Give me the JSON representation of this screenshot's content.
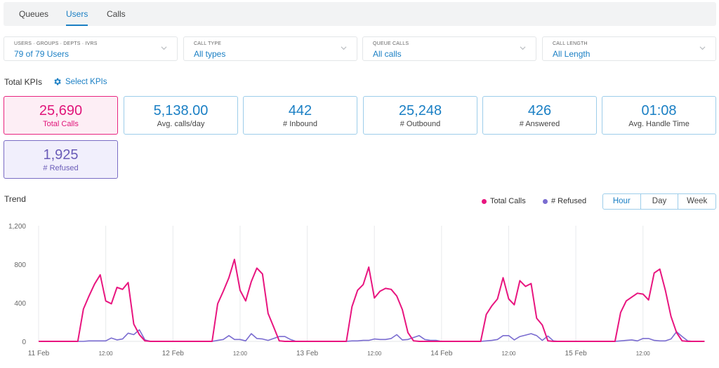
{
  "tabs": [
    {
      "label": "Queues",
      "active": false
    },
    {
      "label": "Users",
      "active": true
    },
    {
      "label": "Calls",
      "active": false
    }
  ],
  "filters": [
    {
      "label": "USERS · GROUPS · DEPTS · IVRS",
      "value": "79 of 79 Users"
    },
    {
      "label": "CALL TYPE",
      "value": "All types"
    },
    {
      "label": "QUEUE CALLS",
      "value": "All calls"
    },
    {
      "label": "CALL LENGTH",
      "value": "All Length"
    }
  ],
  "kpi_section": {
    "title": "Total KPIs",
    "select_label": "Select KPIs",
    "select_icon": "gear-icon"
  },
  "kpis": [
    {
      "value": "25,690",
      "label": "Total Calls",
      "style": "pink"
    },
    {
      "value": "5,138.00",
      "label": "Avg. calls/day",
      "style": "blue"
    },
    {
      "value": "442",
      "label": "# Inbound",
      "style": "blue"
    },
    {
      "value": "25,248",
      "label": "# Outbound",
      "style": "blue"
    },
    {
      "value": "426",
      "label": "# Answered",
      "style": "blue"
    },
    {
      "value": "01:08",
      "label": "Avg. Handle Time",
      "style": "blue"
    },
    {
      "value": "1,925",
      "label": "# Refused",
      "style": "purple"
    }
  ],
  "trend": {
    "title": "Trend",
    "granularity_options": [
      "Hour",
      "Day",
      "Week"
    ],
    "granularity_selected": "Hour"
  },
  "colors": {
    "accent": "#1a7fc4",
    "total_calls": "#e8157f",
    "refused": "#7a6cd0"
  },
  "chart_data": {
    "type": "line",
    "title": "Trend",
    "xlabel": "",
    "ylabel": "",
    "x_unit": "hour",
    "x_start": "11 Feb 00:00",
    "x_tick_labels": [
      "11 Feb",
      "12:00",
      "12 Feb",
      "12:00",
      "13 Feb",
      "12:00",
      "14 Feb",
      "12:00",
      "15 Feb",
      "12:00"
    ],
    "y_ticks": [
      0,
      400,
      800,
      1200
    ],
    "y_tick_labels": [
      "0",
      "400",
      "800",
      "1,200"
    ],
    "ylim": [
      0,
      1200
    ],
    "grid": "vertical",
    "legend": "top-right",
    "series": [
      {
        "name": "Total Calls",
        "color": "#e8157f",
        "values": [
          0,
          0,
          0,
          0,
          0,
          0,
          0,
          0,
          335,
          470,
          595,
          690,
          420,
          390,
          560,
          540,
          610,
          180,
          70,
          5,
          0,
          0,
          0,
          0,
          0,
          0,
          0,
          0,
          0,
          0,
          0,
          0,
          390,
          520,
          660,
          850,
          530,
          420,
          620,
          760,
          700,
          290,
          150,
          5,
          0,
          0,
          0,
          0,
          0,
          0,
          0,
          0,
          0,
          0,
          0,
          0,
          360,
          530,
          590,
          770,
          450,
          520,
          550,
          540,
          470,
          330,
          90,
          5,
          0,
          0,
          0,
          0,
          0,
          0,
          0,
          0,
          0,
          0,
          0,
          0,
          280,
          370,
          440,
          660,
          440,
          380,
          630,
          570,
          600,
          240,
          170,
          5,
          0,
          0,
          0,
          0,
          0,
          0,
          0,
          0,
          0,
          0,
          0,
          0,
          300,
          420,
          460,
          500,
          490,
          430,
          710,
          750,
          530,
          260,
          90,
          5,
          0,
          0,
          0,
          0
        ]
      },
      {
        "name": "# Refused",
        "color": "#7a6cd0",
        "values": [
          0,
          0,
          0,
          0,
          0,
          0,
          0,
          0,
          0,
          5,
          5,
          5,
          5,
          35,
          15,
          25,
          85,
          70,
          120,
          15,
          0,
          0,
          0,
          0,
          0,
          0,
          0,
          0,
          0,
          0,
          0,
          0,
          10,
          20,
          60,
          20,
          20,
          5,
          80,
          30,
          25,
          10,
          30,
          50,
          50,
          20,
          0,
          0,
          0,
          0,
          0,
          0,
          0,
          0,
          0,
          0,
          5,
          5,
          10,
          10,
          25,
          20,
          20,
          30,
          70,
          15,
          20,
          40,
          60,
          20,
          10,
          10,
          0,
          0,
          0,
          0,
          0,
          0,
          0,
          0,
          5,
          10,
          20,
          60,
          60,
          15,
          50,
          65,
          80,
          60,
          10,
          55,
          5,
          0,
          0,
          0,
          0,
          0,
          0,
          0,
          0,
          0,
          0,
          0,
          5,
          10,
          15,
          5,
          30,
          30,
          10,
          5,
          5,
          25,
          100,
          50,
          5,
          0,
          0,
          0
        ]
      }
    ]
  }
}
